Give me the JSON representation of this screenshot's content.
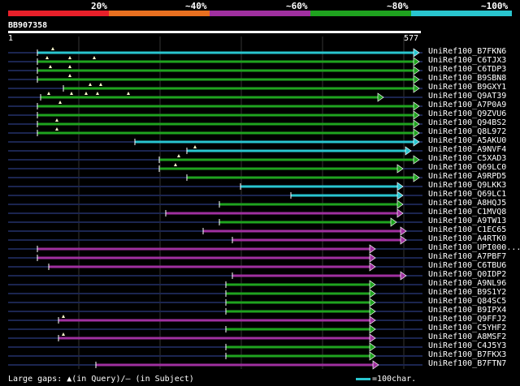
{
  "legend": {
    "segments": [
      {
        "label": "",
        "color": "#e8202a"
      },
      {
        "label": "20%",
        "color": "#e87020"
      },
      {
        "label": "~40%",
        "color": "#a030a0"
      },
      {
        "label": "~60%",
        "color": "#1fa31f"
      },
      {
        "label": "~80%",
        "color": "#29c5cf"
      }
    ],
    "end_label": "~100%"
  },
  "query": {
    "id": "BB907358",
    "start": "1",
    "end": "577"
  },
  "hits": [
    {
      "name": "UniRef100_B7FKN6",
      "color": "#29c5cf",
      "line_from": 10,
      "line_to": 520,
      "start": 46,
      "end": 516,
      "ticks": [
        65
      ],
      "arrow": true
    },
    {
      "name": "UniRef100_C6TJX3",
      "color": "#1fa31f",
      "line_from": 10,
      "line_to": 520,
      "start": 46,
      "end": 516,
      "ticks": [
        58,
        86,
        116
      ],
      "arrow": true
    },
    {
      "name": "UniRef100_C6TDP3",
      "color": "#1fa31f",
      "line_from": 10,
      "line_to": 520,
      "start": 46,
      "end": 516,
      "ticks": [
        62,
        86
      ],
      "arrow": true
    },
    {
      "name": "UniRef100_B9SBN8",
      "color": "#1fa31f",
      "line_from": 10,
      "line_to": 520,
      "start": 46,
      "end": 516,
      "ticks": [
        86
      ],
      "arrow": true
    },
    {
      "name": "UniRef100_B9GXY1",
      "color": "#1fa31f",
      "line_from": 10,
      "line_to": 520,
      "start": 78,
      "end": 516,
      "ticks": [
        111,
        124
      ],
      "arrow": true
    },
    {
      "name": "UniRef100_Q9AT39",
      "color": "#1fa31f",
      "line_from": 10,
      "line_to": 520,
      "start": 50,
      "end": 472,
      "ticks": [
        60,
        88,
        106,
        120,
        158
      ],
      "arrow": true
    },
    {
      "name": "UniRef100_A7P0A9",
      "color": "#1fa31f",
      "line_from": 10,
      "line_to": 520,
      "start": 46,
      "end": 516,
      "ticks": [
        74
      ],
      "arrow": true
    },
    {
      "name": "UniRef100_Q9ZVU6",
      "color": "#1fa31f",
      "line_from": 10,
      "line_to": 520,
      "start": 46,
      "end": 516,
      "ticks": [],
      "arrow": true
    },
    {
      "name": "UniRef100_Q94BS2",
      "color": "#1fa31f",
      "line_from": 10,
      "line_to": 520,
      "start": 46,
      "end": 516,
      "ticks": [
        70
      ],
      "arrow": true
    },
    {
      "name": "UniRef100_Q8L972",
      "color": "#1fa31f",
      "line_from": 10,
      "line_to": 520,
      "start": 46,
      "end": 516,
      "ticks": [
        70
      ],
      "arrow": true
    },
    {
      "name": "UniRef100_A5AKU0",
      "color": "#29c5cf",
      "line_from": 10,
      "line_to": 520,
      "start": 166,
      "end": 516,
      "ticks": [],
      "arrow": true
    },
    {
      "name": "UniRef100_A9NVF4",
      "color": "#29c5cf",
      "line_from": 10,
      "line_to": 520,
      "start": 230,
      "end": 506,
      "ticks": [
        240
      ],
      "arrow": true
    },
    {
      "name": "UniRef100_C5XAD3",
      "color": "#1fa31f",
      "line_from": 10,
      "line_to": 520,
      "start": 196,
      "end": 516,
      "ticks": [
        220
      ],
      "arrow": true
    },
    {
      "name": "UniRef100_Q69LC0",
      "color": "#1fa31f",
      "line_from": 10,
      "line_to": 520,
      "start": 196,
      "end": 496,
      "ticks": [
        216
      ],
      "arrow": true
    },
    {
      "name": "UniRef100_A9RPD5",
      "color": "#1fa31f",
      "line_from": 10,
      "line_to": 520,
      "start": 230,
      "end": 516,
      "ticks": [],
      "arrow": true
    },
    {
      "name": "UniRef100_Q9LKK3",
      "color": "#29c5cf",
      "line_from": 10,
      "line_to": 520,
      "start": 296,
      "end": 496,
      "ticks": [],
      "arrow": true
    },
    {
      "name": "UniRef100_Q69LC1",
      "color": "#29c5cf",
      "line_from": 10,
      "line_to": 520,
      "start": 358,
      "end": 496,
      "ticks": [],
      "arrow": true
    },
    {
      "name": "UniRef100_A8HQJ5",
      "color": "#1fa31f",
      "line_from": 10,
      "line_to": 520,
      "start": 270,
      "end": 496,
      "ticks": [],
      "arrow": true
    },
    {
      "name": "UniRef100_C1MVQ8",
      "color": "#a030a0",
      "line_from": 10,
      "line_to": 520,
      "start": 204,
      "end": 496,
      "ticks": [],
      "arrow": true
    },
    {
      "name": "UniRef100_A9TW13",
      "color": "#1fa31f",
      "line_from": 10,
      "line_to": 520,
      "start": 270,
      "end": 488,
      "ticks": [],
      "arrow": true
    },
    {
      "name": "UniRef100_C1EC65",
      "color": "#a030a0",
      "line_from": 10,
      "line_to": 520,
      "start": 250,
      "end": 500,
      "ticks": [],
      "arrow": true
    },
    {
      "name": "UniRef100_A4RTK0",
      "color": "#a030a0",
      "line_from": 10,
      "line_to": 520,
      "start": 286,
      "end": 500,
      "ticks": [],
      "arrow": true
    },
    {
      "name": "UniRef100_UPI000...",
      "color": "#a030a0",
      "line_from": 10,
      "line_to": 520,
      "start": 46,
      "end": 462,
      "ticks": [],
      "arrow": true
    },
    {
      "name": "UniRef100_A7PBF7",
      "color": "#a030a0",
      "line_from": 10,
      "line_to": 520,
      "start": 46,
      "end": 462,
      "ticks": [],
      "arrow": true
    },
    {
      "name": "UniRef100_C6TBU6",
      "color": "#a030a0",
      "line_from": 10,
      "line_to": 520,
      "start": 60,
      "end": 462,
      "ticks": [],
      "arrow": true
    },
    {
      "name": "UniRef100_Q0IDP2",
      "color": "#a030a0",
      "line_from": 10,
      "line_to": 520,
      "start": 286,
      "end": 500,
      "ticks": [],
      "arrow": true
    },
    {
      "name": "UniRef100_A9NL96",
      "color": "#1fa31f",
      "line_from": 10,
      "line_to": 520,
      "start": 278,
      "end": 462,
      "ticks": [],
      "arrow": true
    },
    {
      "name": "UniRef100_B9S1Y2",
      "color": "#1fa31f",
      "line_from": 10,
      "line_to": 520,
      "start": 278,
      "end": 462,
      "ticks": [],
      "arrow": true
    },
    {
      "name": "UniRef100_Q84SC5",
      "color": "#1fa31f",
      "line_from": 10,
      "line_to": 520,
      "start": 278,
      "end": 462,
      "ticks": [],
      "arrow": true
    },
    {
      "name": "UniRef100_B9IPX4",
      "color": "#1fa31f",
      "line_from": 10,
      "line_to": 520,
      "start": 278,
      "end": 462,
      "ticks": [],
      "arrow": true
    },
    {
      "name": "UniRef100_Q9FFJ2",
      "color": "#a030a0",
      "line_from": 10,
      "line_to": 520,
      "start": 72,
      "end": 462,
      "ticks": [
        78
      ],
      "arrow": true
    },
    {
      "name": "UniRef100_C5YHF2",
      "color": "#1fa31f",
      "line_from": 10,
      "line_to": 520,
      "start": 278,
      "end": 462,
      "ticks": [],
      "arrow": true
    },
    {
      "name": "UniRef100_A8MSF2",
      "color": "#a030a0",
      "line_from": 10,
      "line_to": 520,
      "start": 72,
      "end": 462,
      "ticks": [
        78
      ],
      "arrow": true
    },
    {
      "name": "UniRef100_C4J5Y3",
      "color": "#1fa31f",
      "line_from": 10,
      "line_to": 520,
      "start": 278,
      "end": 462,
      "ticks": [],
      "arrow": true
    },
    {
      "name": "UniRef100_B7FKX3",
      "color": "#1fa31f",
      "line_from": 10,
      "line_to": 520,
      "start": 278,
      "end": 462,
      "ticks": [],
      "arrow": true
    },
    {
      "name": "UniRef100_B7FTN7",
      "color": "#a030a0",
      "line_from": 10,
      "line_to": 520,
      "start": 118,
      "end": 466,
      "ticks": [],
      "arrow": true
    }
  ],
  "footer": {
    "large_gaps_text": "Large gaps: ▲(in Query)/– (in Subject)",
    "scale_text": "=100char."
  }
}
